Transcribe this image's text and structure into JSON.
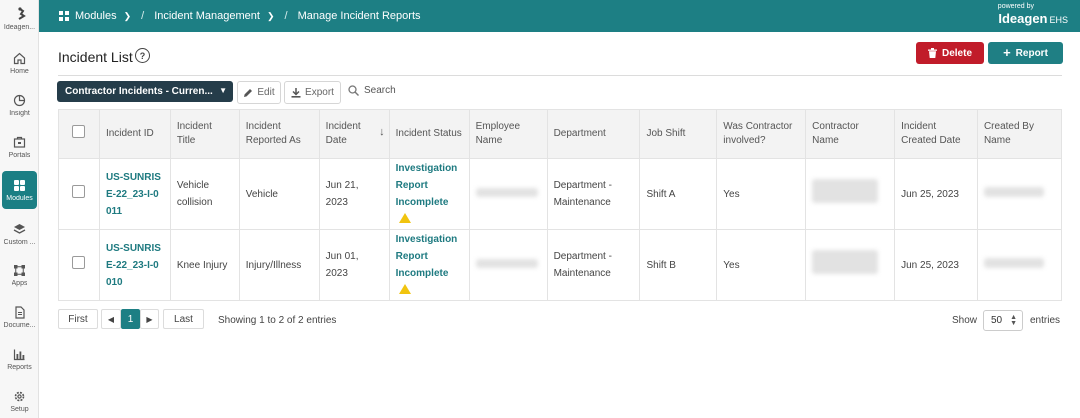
{
  "nav": {
    "items": [
      {
        "label": "Ideagen...",
        "icon": "ideagen-logo-icon"
      },
      {
        "label": "Home",
        "icon": "home-icon"
      },
      {
        "label": "Insight",
        "icon": "pie-chart-icon"
      },
      {
        "label": "Portals",
        "icon": "portal-icon"
      },
      {
        "label": "Modules",
        "icon": "grid-icon"
      },
      {
        "label": "Custom ...",
        "icon": "layers-icon"
      },
      {
        "label": "Apps",
        "icon": "apps-icon"
      },
      {
        "label": "Docume...",
        "icon": "document-icon"
      },
      {
        "label": "Reports",
        "icon": "bar-chart-icon"
      },
      {
        "label": "Setup",
        "icon": "gear-icon"
      }
    ],
    "active": "Modules"
  },
  "topbar": {
    "crumbs": [
      "Modules",
      "Incident Management",
      "Manage Incident Reports"
    ],
    "powered_by": "powered by",
    "brand": "Ideagen",
    "brand_suffix": "EHS"
  },
  "page": {
    "title": "Incident List",
    "help": "?"
  },
  "actions": {
    "delete_label": "Delete",
    "report_label": "Report"
  },
  "toolbar": {
    "view_label": "Contractor Incidents - Curren...",
    "edit_label": "Edit",
    "export_label": "Export",
    "search_label": "Search"
  },
  "table": {
    "headers": [
      "Incident ID",
      "Incident Title",
      "Incident Reported As",
      "Incident Date",
      "Incident Status",
      "Employee Name",
      "Department",
      "Job Shift",
      "Was Contractor involved?",
      "Contractor Name",
      "Incident Created Date",
      "Created By Name"
    ],
    "rows": [
      {
        "id": "US-SUNRISE-22_23-I-0011",
        "title": "Vehicle collision",
        "reported_as": "Vehicle",
        "date": "Jun 21, 2023",
        "status": "Investigation Report Incomplete",
        "department": "Department - Maintenance",
        "shift": "Shift A",
        "contractor": "Yes",
        "created": "Jun 25, 2023"
      },
      {
        "id": "US-SUNRISE-22_23-I-0010",
        "title": "Knee Injury",
        "reported_as": "Injury/Illness",
        "date": "Jun 01, 2023",
        "status": "Investigation Report Incomplete",
        "department": "Department - Maintenance",
        "shift": "Shift B",
        "contractor": "Yes",
        "created": "Jun 25, 2023"
      }
    ]
  },
  "pagination": {
    "first": "First",
    "page": "1",
    "last": "Last",
    "summary": "Showing 1 to 2 of 2 entries",
    "show_label": "Show",
    "page_size": "50",
    "entries_label": "entries"
  },
  "colors": {
    "brand_teal": "#1d7f84",
    "delete_red": "#c11c2a",
    "view_select": "#253d4a",
    "warning": "#f1c40f"
  }
}
